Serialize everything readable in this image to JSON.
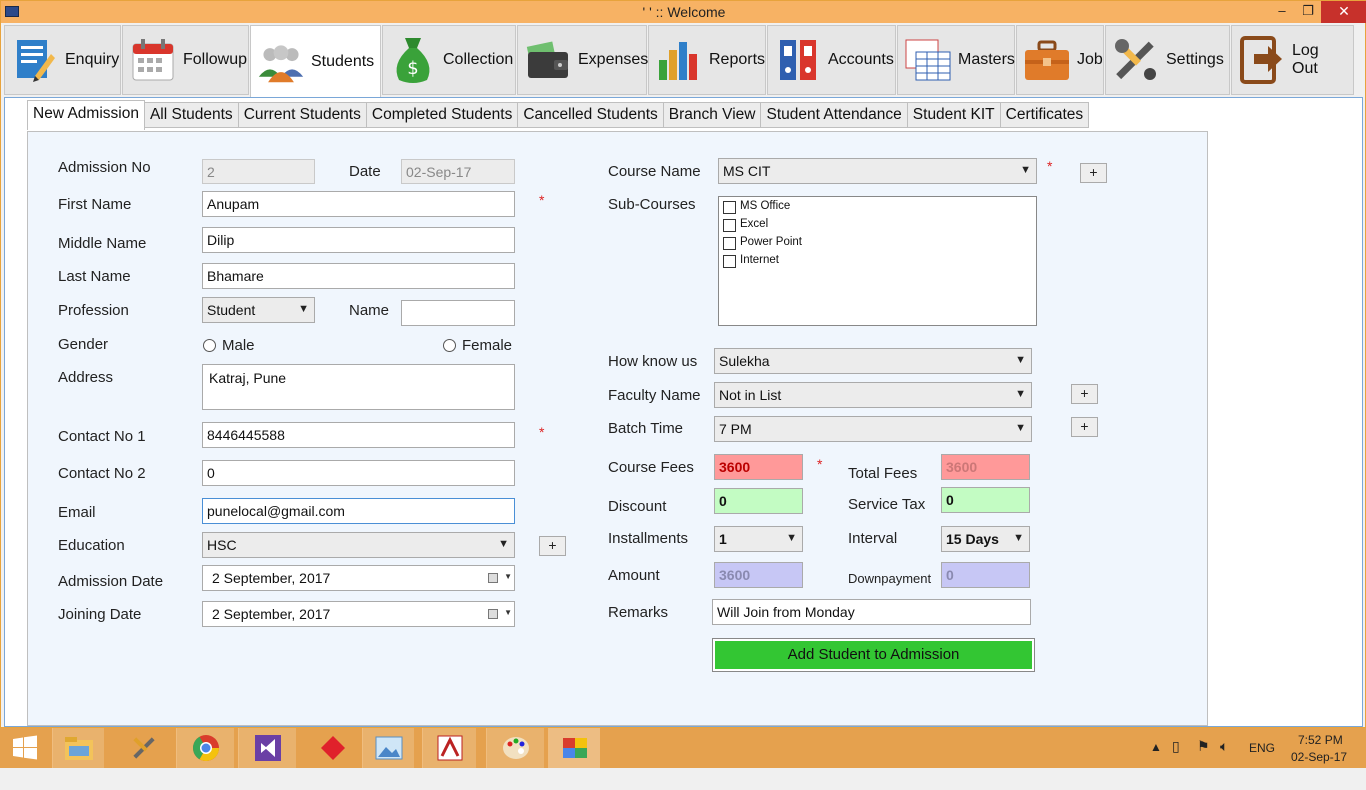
{
  "window": {
    "title": "'  ' :: Welcome",
    "controls": {
      "minimize": "–",
      "restore": "❐",
      "close": "✕"
    }
  },
  "toolbar": {
    "buttons": [
      {
        "label": "Enquiry",
        "icon": "enquiry-icon"
      },
      {
        "label": "Followup",
        "icon": "calendar-icon"
      },
      {
        "label": "Students",
        "icon": "students-icon",
        "active": true
      },
      {
        "label": "Collection",
        "icon": "money-bag-icon"
      },
      {
        "label": "Expenses",
        "icon": "wallet-icon"
      },
      {
        "label": "Reports",
        "icon": "bar-chart-icon"
      },
      {
        "label": "Accounts",
        "icon": "binders-icon"
      },
      {
        "label": "Masters",
        "icon": "table-icon"
      },
      {
        "label": "Job",
        "icon": "briefcase-icon"
      },
      {
        "label": "Settings",
        "icon": "tools-icon"
      },
      {
        "label": "Log Out",
        "icon": "logout-icon"
      }
    ]
  },
  "tabs": [
    {
      "label": "New Admission",
      "active": true
    },
    {
      "label": "All Students"
    },
    {
      "label": "Current Students"
    },
    {
      "label": "Completed Students"
    },
    {
      "label": "Cancelled Students"
    },
    {
      "label": "Branch View"
    },
    {
      "label": "Student Attendance"
    },
    {
      "label": "Student KIT"
    },
    {
      "label": "Certificates"
    }
  ],
  "form_left": {
    "admission_no_label": "Admission No",
    "admission_no": "2",
    "date_label": "Date",
    "date": "02-Sep-17",
    "first_name_label": "First Name",
    "first_name": "Anupam",
    "middle_name_label": "Middle Name",
    "middle_name": "Dilip",
    "last_name_label": "Last Name",
    "last_name": "Bhamare",
    "profession_label": "Profession",
    "profession": "Student",
    "name_label": "Name",
    "name": "",
    "gender_label": "Gender",
    "gender_male": "Male",
    "gender_female": "Female",
    "address_label": "Address",
    "address": "Katraj, Pune",
    "contact1_label": "Contact No 1",
    "contact1": "8446445588",
    "contact2_label": "Contact No 2",
    "contact2": "0",
    "email_label": "Email",
    "email": "punelocal@gmail.com",
    "education_label": "Education",
    "education": "HSC",
    "admission_date_label": "Admission Date",
    "admission_date": "2 September, 2017",
    "joining_date_label": "Joining Date",
    "joining_date": "2 September, 2017",
    "required_mark": "*",
    "plus": "+"
  },
  "form_right": {
    "course_name_label": "Course Name",
    "course_name": "MS CIT",
    "sub_courses_label": "Sub-Courses",
    "sub_courses": [
      "MS Office",
      "Excel",
      "Power Point",
      "Internet"
    ],
    "how_know_label": "How know us",
    "how_know": "Sulekha",
    "faculty_label": "Faculty Name",
    "faculty": "Not in List",
    "batch_label": "Batch Time",
    "batch": "7 PM",
    "course_fees_label": "Course Fees",
    "course_fees": "3600",
    "total_fees_label": "Total Fees",
    "total_fees": "3600",
    "discount_label": "Discount",
    "discount": "0",
    "service_tax_label": "Service Tax",
    "service_tax": "0",
    "installments_label": "Installments",
    "installments": "1",
    "interval_label": "Interval",
    "interval": "15 Days",
    "amount_label": "Amount",
    "amount": "3600",
    "downpayment_label": "Downpayment",
    "downpayment": "0",
    "remarks_label": "Remarks",
    "remarks": "Will Join from Monday",
    "submit_label": "Add Student to Admission"
  },
  "taskbar": {
    "lang": "ENG",
    "time": "7:52 PM",
    "date": "02-Sep-17"
  }
}
